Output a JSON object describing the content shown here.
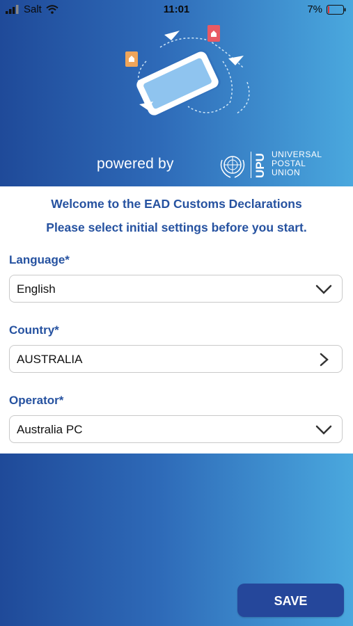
{
  "status_bar": {
    "carrier": "Salt",
    "time": "11:01",
    "battery": "7%"
  },
  "header": {
    "powered_by": "powered by",
    "upu_mark": "UPU",
    "org_lines": [
      "UNIVERSAL",
      "POSTAL",
      "UNION"
    ]
  },
  "welcome": {
    "line1": "Welcome to the EAD Customs Declarations",
    "line2": "Please select initial settings before you start."
  },
  "fields": {
    "language": {
      "label": "Language*",
      "value": "English",
      "icon": "chevron-down-icon"
    },
    "country": {
      "label": "Country*",
      "value": "AUSTRALIA",
      "icon": "chevron-right-icon"
    },
    "operator": {
      "label": "Operator*",
      "value": "Australia PC",
      "icon": "chevron-down-icon"
    }
  },
  "actions": {
    "save_label": "SAVE"
  },
  "colors": {
    "primary_text": "#2652a0",
    "button": "#25479b",
    "gradient_start": "#1f4a99",
    "gradient_end": "#4aa8de"
  }
}
